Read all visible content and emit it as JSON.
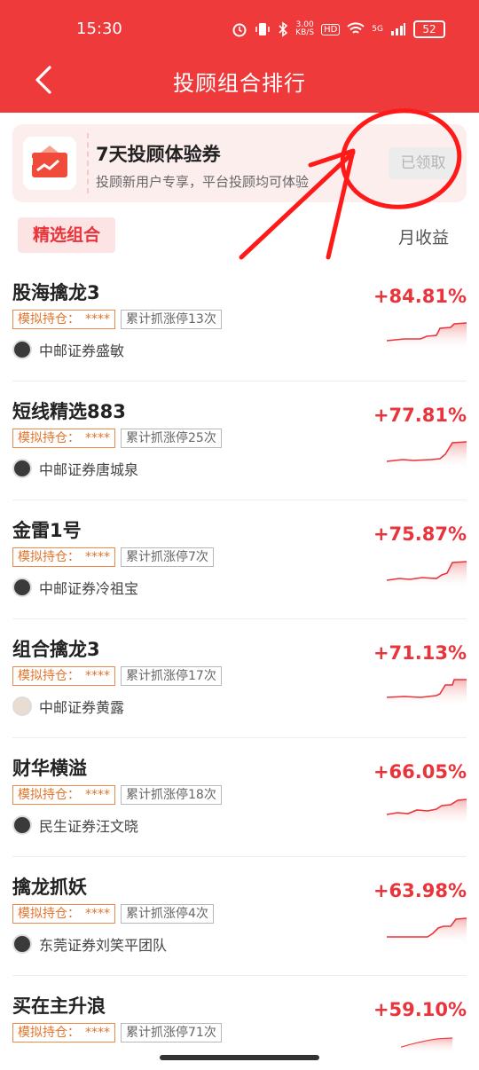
{
  "status": {
    "time": "15:30",
    "net_speed_top": "3.00",
    "net_speed_bottom": "KB/S",
    "hd": "HD",
    "signal": "5G",
    "battery": "52"
  },
  "header": {
    "title": "投顾组合排行"
  },
  "coupon": {
    "title": "7天投顾体验券",
    "subtitle": "投顾新用户专享，平台投顾均可体验",
    "button_label": "已领取"
  },
  "filter": {
    "selected_tab": "精选组合",
    "sort_label": "月收益"
  },
  "portfolios": [
    {
      "name": "股海擒龙3",
      "hold_label": "模拟持仓：",
      "hold_stars": "****",
      "count_label": "累计抓涨停13次",
      "advisor": "中邮证券盛敏",
      "yield": "+84.81%"
    },
    {
      "name": "短线精选883",
      "hold_label": "模拟持仓：",
      "hold_stars": "****",
      "count_label": "累计抓涨停25次",
      "advisor": "中邮证券唐城泉",
      "yield": "+77.81%"
    },
    {
      "name": "金雷1号",
      "hold_label": "模拟持仓：",
      "hold_stars": "****",
      "count_label": "累计抓涨停7次",
      "advisor": "中邮证券冷祖宝",
      "yield": "+75.87%"
    },
    {
      "name": "组合擒龙3",
      "hold_label": "模拟持仓：",
      "hold_stars": "****",
      "count_label": "累计抓涨停17次",
      "advisor": "中邮证券黄露",
      "yield": "+71.13%"
    },
    {
      "name": "财华横溢",
      "hold_label": "模拟持仓：",
      "hold_stars": "****",
      "count_label": "累计抓涨停18次",
      "advisor": "民生证券汪文晓",
      "yield": "+66.05%"
    },
    {
      "name": "擒龙抓妖",
      "hold_label": "模拟持仓：",
      "hold_stars": "****",
      "count_label": "累计抓涨停4次",
      "advisor": "东莞证券刘笑平团队",
      "yield": "+63.98%"
    },
    {
      "name": "买在主升浪",
      "hold_label": "模拟持仓：",
      "hold_stars": "****",
      "count_label": "累计抓涨停71次",
      "advisor": "",
      "yield": "+59.10%"
    }
  ],
  "colors": {
    "brand_red": "#ee3a3a",
    "yield_red": "#e8343a",
    "hold_orange": "#e2742c"
  }
}
